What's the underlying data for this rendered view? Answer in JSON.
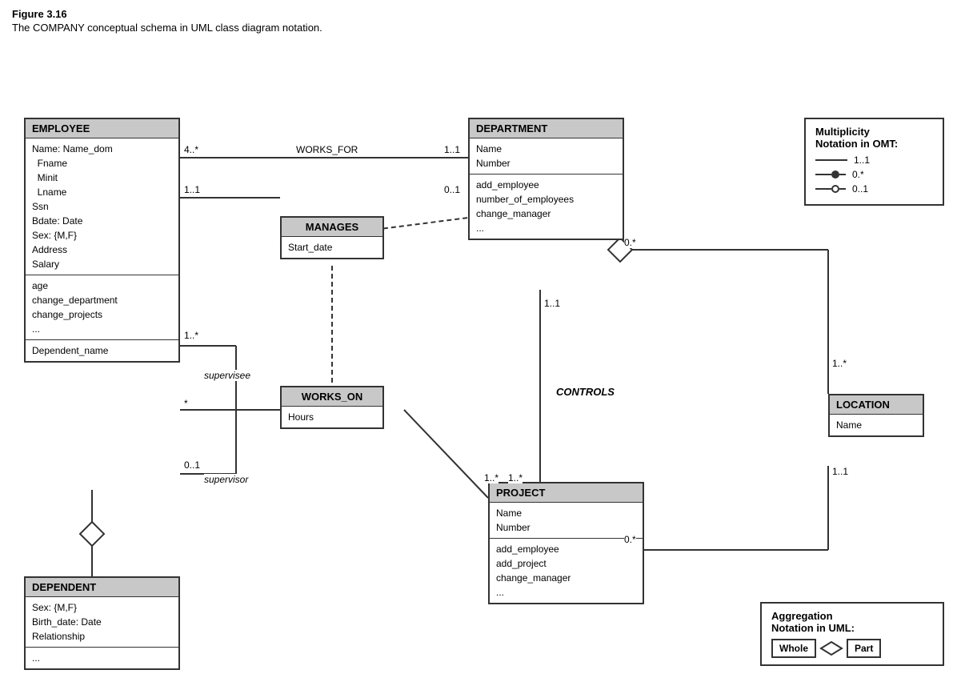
{
  "figure": {
    "title": "Figure 3.16",
    "caption": "The COMPANY conceptual schema in UML class diagram notation."
  },
  "classes": {
    "employee": {
      "header": "EMPLOYEE",
      "section1": [
        "Name: Name_dom",
        "  Fname",
        "  Minit",
        "  Lname",
        "Ssn",
        "Bdate: Date",
        "Sex: {M,F}",
        "Address",
        "Salary"
      ],
      "section2": [
        "age",
        "change_department",
        "change_projects",
        "..."
      ],
      "section3": [
        "Dependent_name"
      ]
    },
    "department": {
      "header": "DEPARTMENT",
      "section1": [
        "Name",
        "Number"
      ],
      "section2": [
        "add_employee",
        "number_of_employees",
        "change_manager",
        "..."
      ]
    },
    "project": {
      "header": "PROJECT",
      "section1": [
        "Name",
        "Number"
      ],
      "section2": [
        "add_employee",
        "add_project",
        "change_manager",
        "..."
      ]
    },
    "dependent": {
      "header": "DEPENDENT",
      "section1": [
        "Sex: {M,F}",
        "Birth_date: Date",
        "Relationship"
      ],
      "section2": [
        "..."
      ]
    },
    "location": {
      "header": "LOCATION",
      "section1": [
        "Name"
      ]
    }
  },
  "associations": {
    "manages": {
      "header": "MANAGES",
      "body": "Start_date"
    },
    "works_on": {
      "header": "WORKS_ON",
      "body": "Hours"
    }
  },
  "multiplicities": {
    "works_for_left": "4..*",
    "works_for_label": "WORKS_FOR",
    "works_for_right": "1..1",
    "manages_left": "1..1",
    "manages_right": "0..1",
    "supervises_top": "1..*",
    "supervises_bottom": "0..1",
    "supervisee_label": "supervisee",
    "supervisor_label": "supervisor",
    "controls_label": "CONTROLS",
    "controls_dept": "1..1",
    "controls_proj": "1..*",
    "works_on_emp": "*",
    "works_on_proj": "1..*",
    "dept_location": "0.*",
    "location_dept": "1..*",
    "location_proj": "0.*",
    "location_loc": "1..1"
  },
  "notation": {
    "title_line1": "Multiplicity",
    "title_line2": "Notation in OMT:",
    "row1_value": "1..1",
    "row2_value": "0.*",
    "row3_value": "0..1"
  },
  "aggregation": {
    "title_line1": "Aggregation",
    "title_line2": "Notation in UML:",
    "whole_label": "Whole",
    "part_label": "Part"
  }
}
